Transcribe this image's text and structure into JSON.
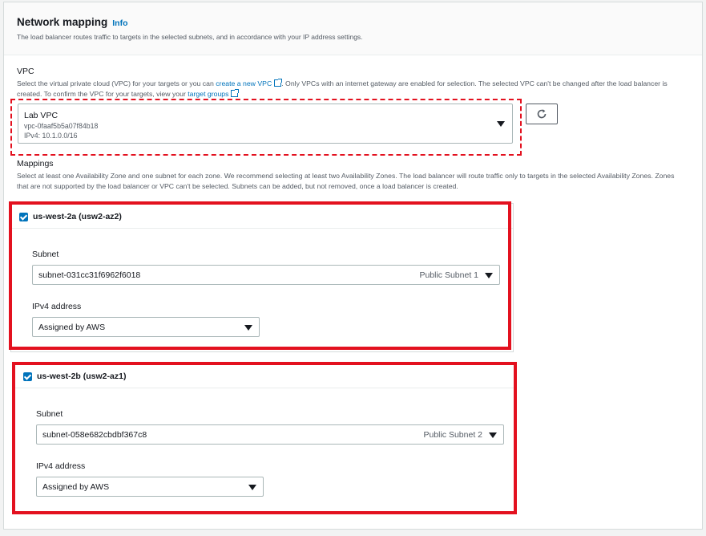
{
  "section": {
    "title": "Network mapping",
    "info": "Info",
    "description": "The load balancer routes traffic to targets in the selected subnets, and in accordance with your IP address settings."
  },
  "vpc": {
    "label": "VPC",
    "desc_part1": "Select the virtual private cloud (VPC) for your targets or you can ",
    "create_link": "create a new VPC",
    "desc_part2": ". Only VPCs with an internet gateway are enabled for selection. The selected VPC can't be changed after the load balancer is created. To confirm the VPC for your targets, view your ",
    "target_link": "target groups",
    "selected_name": "Lab VPC",
    "selected_id": "vpc-0faaf5b5a07f84b18",
    "selected_cidr": "IPv4: 10.1.0.0/16"
  },
  "mappings": {
    "label": "Mappings",
    "description": "Select at least one Availability Zone and one subnet for each zone. We recommend selecting at least two Availability Zones. The load balancer will route traffic only to targets in the selected Availability Zones. Zones that are not supported by the load balancer or VPC can't be selected. Subnets can be added, but not removed, once a load balancer is created.",
    "zones": [
      {
        "name": "us-west-2a (usw2-az2)",
        "checked": true,
        "subnet_label": "Subnet",
        "subnet_id": "subnet-031cc31f6962f6018",
        "subnet_name": "Public Subnet 1",
        "ip_label": "IPv4 address",
        "ip_value": "Assigned by AWS"
      },
      {
        "name": "us-west-2b (usw2-az1)",
        "checked": true,
        "subnet_label": "Subnet",
        "subnet_id": "subnet-058e682cbdbf367c8",
        "subnet_name": "Public Subnet 2",
        "ip_label": "IPv4 address",
        "ip_value": "Assigned by AWS"
      }
    ]
  },
  "colors": {
    "accent": "#0073bb",
    "highlight": "#e3111f"
  }
}
